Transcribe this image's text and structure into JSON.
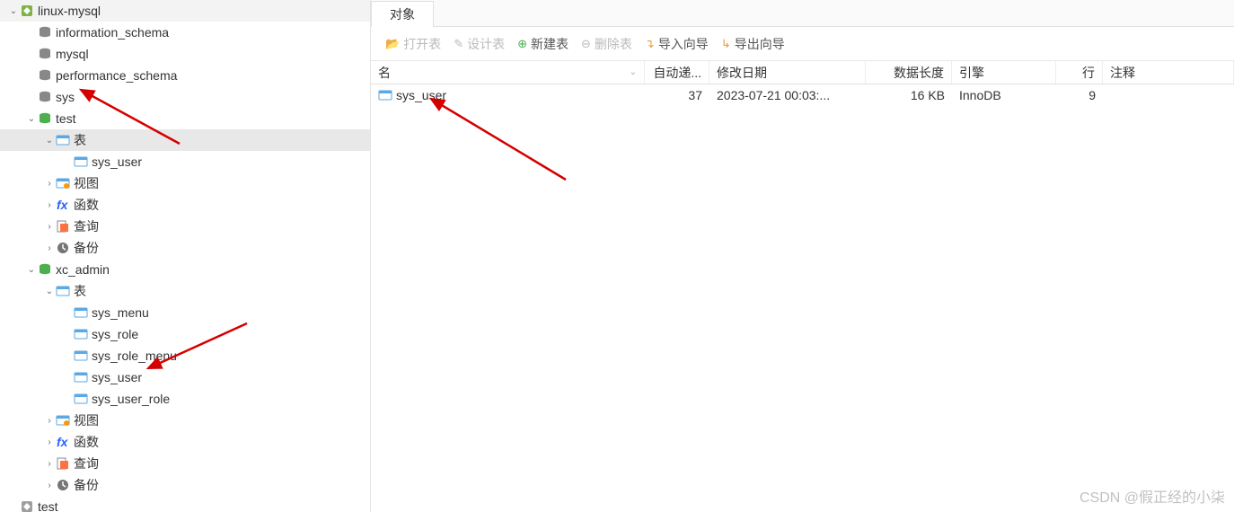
{
  "tab": {
    "label": "对象"
  },
  "toolbar": {
    "open": "打开表",
    "design": "设计表",
    "new": "新建表",
    "delete": "删除表",
    "import": "导入向导",
    "export": "导出向导"
  },
  "headers": {
    "name": "名",
    "auto": "自动递...",
    "date": "修改日期",
    "len": "数据长度",
    "engine": "引擎",
    "rows": "行",
    "comment": "注释"
  },
  "rows": [
    {
      "name": "sys_user",
      "auto": "37",
      "date": "2023-07-21 00:03:...",
      "len": "16 KB",
      "engine": "InnoDB",
      "rownum": "9",
      "comment": ""
    }
  ],
  "tree": [
    {
      "lvl": 0,
      "twisty": "v",
      "icon": "conn-green",
      "label": "linux-mysql"
    },
    {
      "lvl": 1,
      "twisty": "",
      "icon": "db-gray",
      "label": "information_schema"
    },
    {
      "lvl": 1,
      "twisty": "",
      "icon": "db-gray",
      "label": "mysql"
    },
    {
      "lvl": 1,
      "twisty": "",
      "icon": "db-gray",
      "label": "performance_schema"
    },
    {
      "lvl": 1,
      "twisty": "",
      "icon": "db-gray",
      "label": "sys"
    },
    {
      "lvl": 1,
      "twisty": "v",
      "icon": "db-green",
      "label": "test"
    },
    {
      "lvl": 2,
      "twisty": "v",
      "icon": "tables",
      "label": "表",
      "selected": true
    },
    {
      "lvl": 3,
      "twisty": "",
      "icon": "table",
      "label": "sys_user"
    },
    {
      "lvl": 2,
      "twisty": ">",
      "icon": "view",
      "label": "视图"
    },
    {
      "lvl": 2,
      "twisty": ">",
      "icon": "fx",
      "label": "函数"
    },
    {
      "lvl": 2,
      "twisty": ">",
      "icon": "query",
      "label": "查询"
    },
    {
      "lvl": 2,
      "twisty": ">",
      "icon": "backup",
      "label": "备份"
    },
    {
      "lvl": 1,
      "twisty": "v",
      "icon": "db-green",
      "label": "xc_admin"
    },
    {
      "lvl": 2,
      "twisty": "v",
      "icon": "tables",
      "label": "表"
    },
    {
      "lvl": 3,
      "twisty": "",
      "icon": "table",
      "label": "sys_menu"
    },
    {
      "lvl": 3,
      "twisty": "",
      "icon": "table",
      "label": "sys_role"
    },
    {
      "lvl": 3,
      "twisty": "",
      "icon": "table",
      "label": "sys_role_menu"
    },
    {
      "lvl": 3,
      "twisty": "",
      "icon": "table",
      "label": "sys_user"
    },
    {
      "lvl": 3,
      "twisty": "",
      "icon": "table",
      "label": "sys_user_role"
    },
    {
      "lvl": 2,
      "twisty": ">",
      "icon": "view",
      "label": "视图"
    },
    {
      "lvl": 2,
      "twisty": ">",
      "icon": "fx",
      "label": "函数"
    },
    {
      "lvl": 2,
      "twisty": ">",
      "icon": "query",
      "label": "查询"
    },
    {
      "lvl": 2,
      "twisty": ">",
      "icon": "backup",
      "label": "备份"
    },
    {
      "lvl": 0,
      "twisty": "",
      "icon": "conn-gray",
      "label": "test"
    }
  ],
  "watermark": "CSDN @假正经的小柒"
}
